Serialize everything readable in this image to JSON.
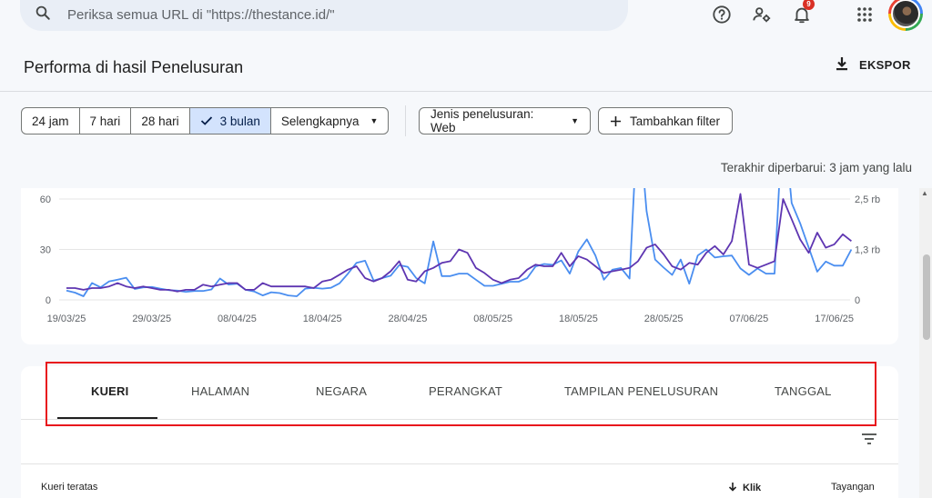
{
  "search": {
    "placeholder": "Periksa semua URL di \"https://thestance.id/\""
  },
  "header": {
    "title": "Performa di hasil Penelusuran",
    "export_label": "EKSPOR",
    "notification_count": "9"
  },
  "filters": {
    "ranges": [
      "24 jam",
      "7 hari",
      "28 hari",
      "3 bulan",
      "Selengkapnya"
    ],
    "selected": "3 bulan",
    "search_type": "Jenis penelusuran: Web",
    "add_filter": "Tambahkan filter"
  },
  "last_updated": "Terakhir diperbarui: 3 jam yang lalu",
  "chart_data": {
    "type": "line",
    "x": [
      "19/03/25",
      "20/03/25",
      "21/03/25",
      "22/03/25",
      "23/03/25",
      "24/03/25",
      "25/03/25",
      "26/03/25",
      "27/03/25",
      "28/03/25",
      "29/03/25",
      "30/03/25",
      "31/03/25",
      "01/04/25",
      "02/04/25",
      "03/04/25",
      "04/04/25",
      "05/04/25",
      "06/04/25",
      "07/04/25",
      "08/04/25",
      "09/04/25",
      "10/04/25",
      "11/04/25",
      "12/04/25",
      "13/04/25",
      "14/04/25",
      "15/04/25",
      "16/04/25",
      "17/04/25",
      "18/04/25",
      "19/04/25",
      "20/04/25",
      "21/04/25",
      "22/04/25",
      "23/04/25",
      "24/04/25",
      "25/04/25",
      "26/04/25",
      "27/04/25",
      "28/04/25",
      "29/04/25",
      "30/04/25",
      "01/05/25",
      "02/05/25",
      "03/05/25",
      "04/05/25",
      "05/05/25",
      "06/05/25",
      "07/05/25",
      "08/05/25",
      "09/05/25",
      "10/05/25",
      "11/05/25",
      "12/05/25",
      "13/05/25",
      "14/05/25",
      "15/05/25",
      "16/05/25",
      "17/05/25",
      "18/05/25",
      "19/05/25",
      "20/05/25",
      "21/05/25",
      "22/05/25",
      "23/05/25",
      "24/05/25",
      "25/05/25",
      "26/05/25",
      "27/05/25",
      "28/05/25",
      "29/05/25",
      "30/05/25",
      "31/05/25",
      "01/06/25",
      "02/06/25",
      "03/06/25",
      "04/06/25",
      "05/06/25",
      "06/06/25",
      "07/06/25",
      "08/06/25",
      "09/06/25",
      "10/06/25",
      "11/06/25",
      "12/06/25",
      "13/06/25",
      "14/06/25",
      "15/06/25",
      "16/06/25",
      "17/06/25",
      "18/06/25"
    ],
    "x_ticks": [
      "19/03/25",
      "29/03/25",
      "08/04/25",
      "18/04/25",
      "28/04/25",
      "08/05/25",
      "18/05/25",
      "28/05/25",
      "07/06/25",
      "17/06/25"
    ],
    "y_left_ticks": [
      "0",
      "30",
      "60"
    ],
    "y_right_ticks": [
      "0",
      "1,3 rb",
      "2,5 rb"
    ],
    "ylim_left": [
      0,
      60
    ],
    "ylim_right": [
      0,
      2500
    ],
    "series": [
      {
        "color": "#5e35b1",
        "axis": "left",
        "values": [
          7,
          7,
          6,
          7,
          7,
          8,
          10,
          8,
          7,
          8,
          7,
          6,
          6,
          5,
          6,
          6,
          9,
          8,
          9,
          10,
          10,
          6,
          6,
          10,
          8,
          8,
          8,
          8,
          8,
          7,
          11,
          12,
          15,
          18,
          20,
          13,
          11,
          13,
          17,
          23,
          12,
          11,
          17,
          19,
          22,
          23,
          30,
          28,
          19,
          16,
          12,
          10,
          12,
          13,
          18,
          21,
          20,
          20,
          28,
          20,
          26,
          24,
          20,
          16,
          17,
          18,
          19,
          23,
          31,
          33,
          27,
          20,
          18,
          22,
          21,
          28,
          32,
          27,
          35,
          63,
          21,
          19,
          21,
          23,
          60,
          48,
          36,
          28,
          40,
          31,
          33,
          39,
          35
        ]
      },
      {
        "color": "#4a8ef0",
        "axis": "right",
        "values": [
          230,
          180,
          90,
          420,
          310,
          460,
          500,
          550,
          270,
          310,
          320,
          280,
          240,
          230,
          200,
          220,
          220,
          260,
          530,
          380,
          400,
          250,
          210,
          110,
          190,
          170,
          110,
          90,
          280,
          300,
          280,
          300,
          410,
          650,
          920,
          970,
          480,
          540,
          600,
          860,
          820,
          540,
          410,
          1450,
          590,
          590,
          650,
          650,
          500,
          350,
          350,
          400,
          450,
          450,
          540,
          830,
          890,
          870,
          980,
          650,
          1200,
          1500,
          1100,
          500,
          750,
          790,
          530,
          4700,
          2200,
          1000,
          800,
          620,
          1000,
          400,
          1100,
          1250,
          1050,
          1080,
          1100,
          780,
          620,
          780,
          650,
          650,
          4700,
          2400,
          1900,
          1300,
          700,
          950,
          850,
          850,
          1250
        ]
      }
    ]
  },
  "tabs": [
    "KUERI",
    "HALAMAN",
    "NEGARA",
    "PERANGKAT",
    "TAMPILAN PENELUSURAN",
    "TANGGAL"
  ],
  "table": {
    "title": "Kueri teratas",
    "columns": [
      "Klik",
      "Tayangan"
    ]
  }
}
